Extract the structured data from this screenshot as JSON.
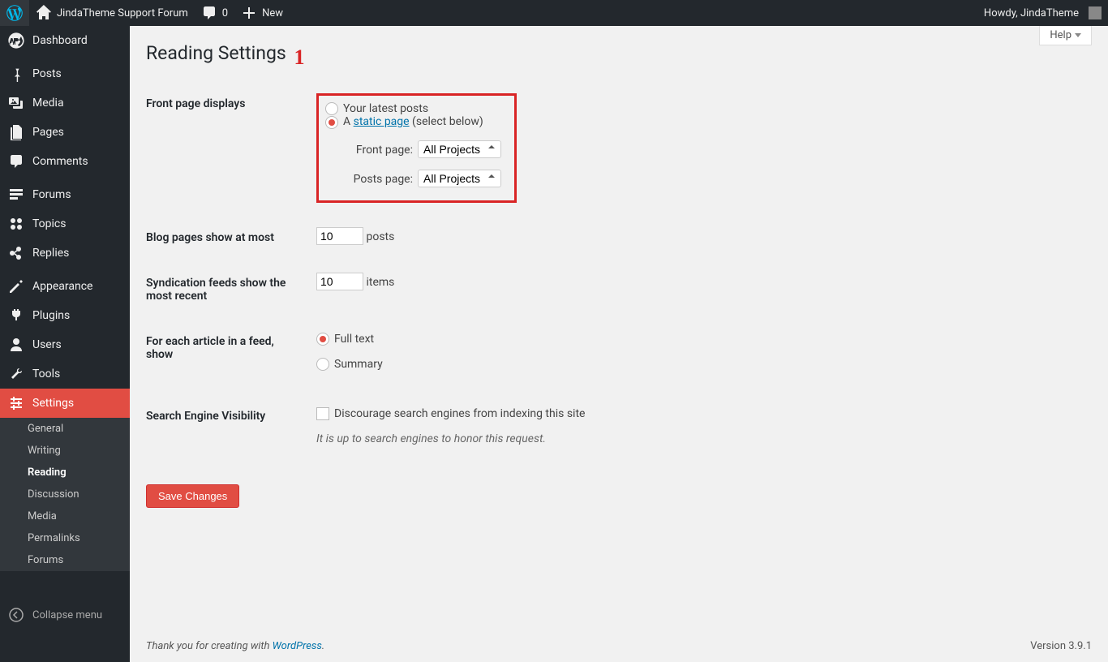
{
  "toolbar": {
    "site_name": "JindaTheme Support Forum",
    "comment_count": "0",
    "new_label": "New",
    "howdy": "Howdy, JindaTheme"
  },
  "admin_menu": {
    "items": [
      {
        "label": "Dashboard",
        "icon": "dashboard"
      },
      {
        "label": "Posts",
        "icon": "pin"
      },
      {
        "label": "Media",
        "icon": "media"
      },
      {
        "label": "Pages",
        "icon": "pages"
      },
      {
        "label": "Comments",
        "icon": "comments"
      },
      {
        "label": "Forums",
        "icon": "forums"
      },
      {
        "label": "Topics",
        "icon": "topics"
      },
      {
        "label": "Replies",
        "icon": "replies"
      },
      {
        "label": "Appearance",
        "icon": "appearance"
      },
      {
        "label": "Plugins",
        "icon": "plugins"
      },
      {
        "label": "Users",
        "icon": "users"
      },
      {
        "label": "Tools",
        "icon": "tools"
      },
      {
        "label": "Settings",
        "icon": "settings",
        "current": true
      }
    ],
    "submenu": [
      "General",
      "Writing",
      "Reading",
      "Discussion",
      "Media",
      "Permalinks",
      "Forums"
    ],
    "submenu_current": "Reading",
    "collapse": "Collapse menu"
  },
  "page": {
    "title": "Reading Settings",
    "help": "Help",
    "annotation": "1"
  },
  "settings": {
    "front_page_displays": {
      "label": "Front page displays",
      "opt_latest": "Your latest posts",
      "opt_static_a": "A ",
      "opt_static_link": "static page",
      "opt_static_suffix": " (select below)",
      "front_page_label": "Front page:",
      "front_page_value": "All Projects",
      "posts_page_label": "Posts page:",
      "posts_page_value": "All Projects"
    },
    "blog_pages": {
      "label": "Blog pages show at most",
      "value": "10",
      "unit": "posts"
    },
    "syndication": {
      "label": "Syndication feeds show the most recent",
      "value": "10",
      "unit": "items"
    },
    "feed_article": {
      "label": "For each article in a feed, show",
      "opt_full": "Full text",
      "opt_summary": "Summary"
    },
    "search_engine": {
      "label": "Search Engine Visibility",
      "check_label": "Discourage search engines from indexing this site",
      "description": "It is up to search engines to honor this request."
    },
    "save": "Save Changes"
  },
  "footer": {
    "thanks_pre": "Thank you for creating with ",
    "thanks_link": "WordPress",
    "thanks_suffix": ".",
    "version": "Version 3.9.1"
  }
}
